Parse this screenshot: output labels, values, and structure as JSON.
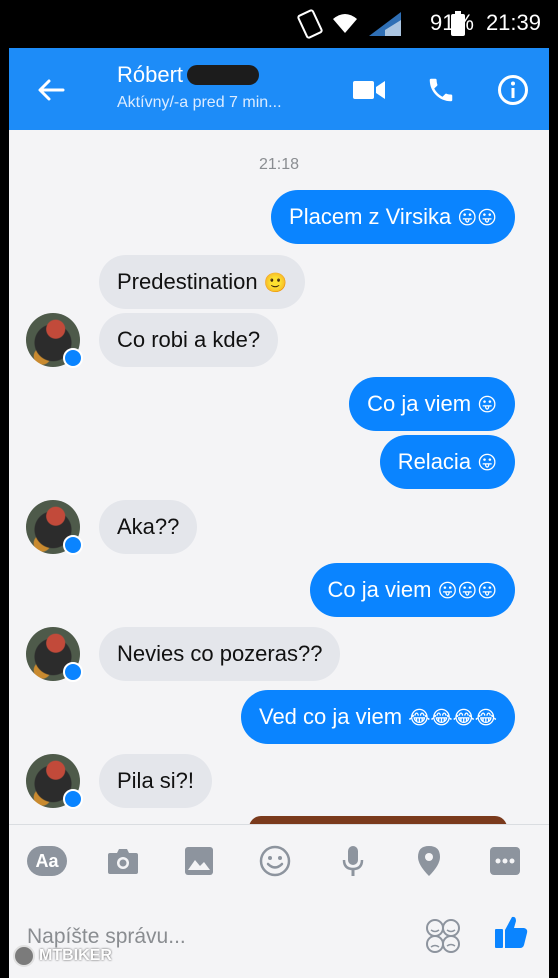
{
  "status_bar": {
    "battery": "91%",
    "time": "21:39",
    "icons": [
      "screen-rotation-icon",
      "wifi-icon",
      "signal-icon",
      "battery-icon"
    ]
  },
  "header": {
    "name": "Róbert",
    "status": "Aktívny/-a pred 7 min...",
    "icons": [
      "back-arrow-icon",
      "video-call-icon",
      "phone-icon",
      "info-icon"
    ]
  },
  "chat": {
    "timestamp": "21:18",
    "messages": [
      {
        "dir": "out",
        "text": "Placem z Virsika",
        "emoji": "😛😛"
      },
      {
        "dir": "in",
        "text": "Predestination",
        "emoji": "🙂"
      },
      {
        "dir": "in",
        "text": "Co robi a kde?",
        "emoji": ""
      },
      {
        "dir": "out",
        "text": "Co ja viem",
        "emoji": "😛"
      },
      {
        "dir": "out",
        "text": "Relacia",
        "emoji": "😛"
      },
      {
        "dir": "in",
        "text": "Aka??",
        "emoji": ""
      },
      {
        "dir": "out",
        "text": "Co ja viem",
        "emoji": "😛😛😛"
      },
      {
        "dir": "in",
        "text": "Nevies co pozeras??",
        "emoji": ""
      },
      {
        "dir": "out",
        "text": "Ved co ja viem",
        "emoji": "😂😂😂😂"
      },
      {
        "dir": "in",
        "text": "Pila si?!",
        "emoji": ""
      }
    ]
  },
  "toolbar": {
    "aa_label": "Aa",
    "icons": [
      "camera-icon",
      "gallery-icon",
      "emoji-icon",
      "microphone-icon",
      "location-icon",
      "more-icon"
    ]
  },
  "composer": {
    "placeholder": "Napíšte správu...",
    "icons": [
      "sticker-icon",
      "like-icon"
    ]
  },
  "watermark": "MTBIKER",
  "colors": {
    "brand_blue": "#1d8cf8",
    "outgoing_bubble": "#0a84ff",
    "incoming_bubble": "#e4e6eb"
  }
}
